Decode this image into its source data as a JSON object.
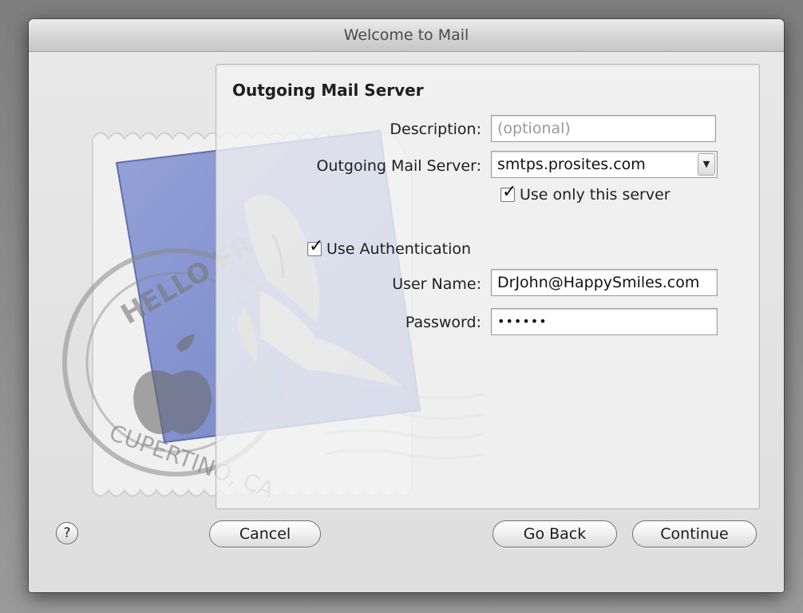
{
  "window": {
    "title": "Welcome to Mail"
  },
  "panel": {
    "title": "Outgoing Mail Server"
  },
  "form": {
    "description": {
      "label": "Description:",
      "value": "",
      "placeholder": "(optional)"
    },
    "outgoing_server": {
      "label": "Outgoing Mail Server:",
      "value": "smtps.prosites.com"
    },
    "use_only_this_server": {
      "label": "Use only this server",
      "checked": true
    },
    "use_authentication": {
      "label": "Use Authentication",
      "checked": true
    },
    "user_name": {
      "label": "User Name:",
      "value": "DrJohn@HappySmiles.com"
    },
    "password": {
      "label": "Password:",
      "value": "••••••"
    }
  },
  "buttons": {
    "help": "?",
    "cancel": "Cancel",
    "go_back": "Go Back",
    "continue": "Continue"
  },
  "stamp": {
    "text_top": "HELLO FROM",
    "text_bottom": "CUPERTINO, CA"
  },
  "icons": {
    "checkmark": "check-icon",
    "dropdown": "chevron-down-icon",
    "help": "question-icon"
  }
}
